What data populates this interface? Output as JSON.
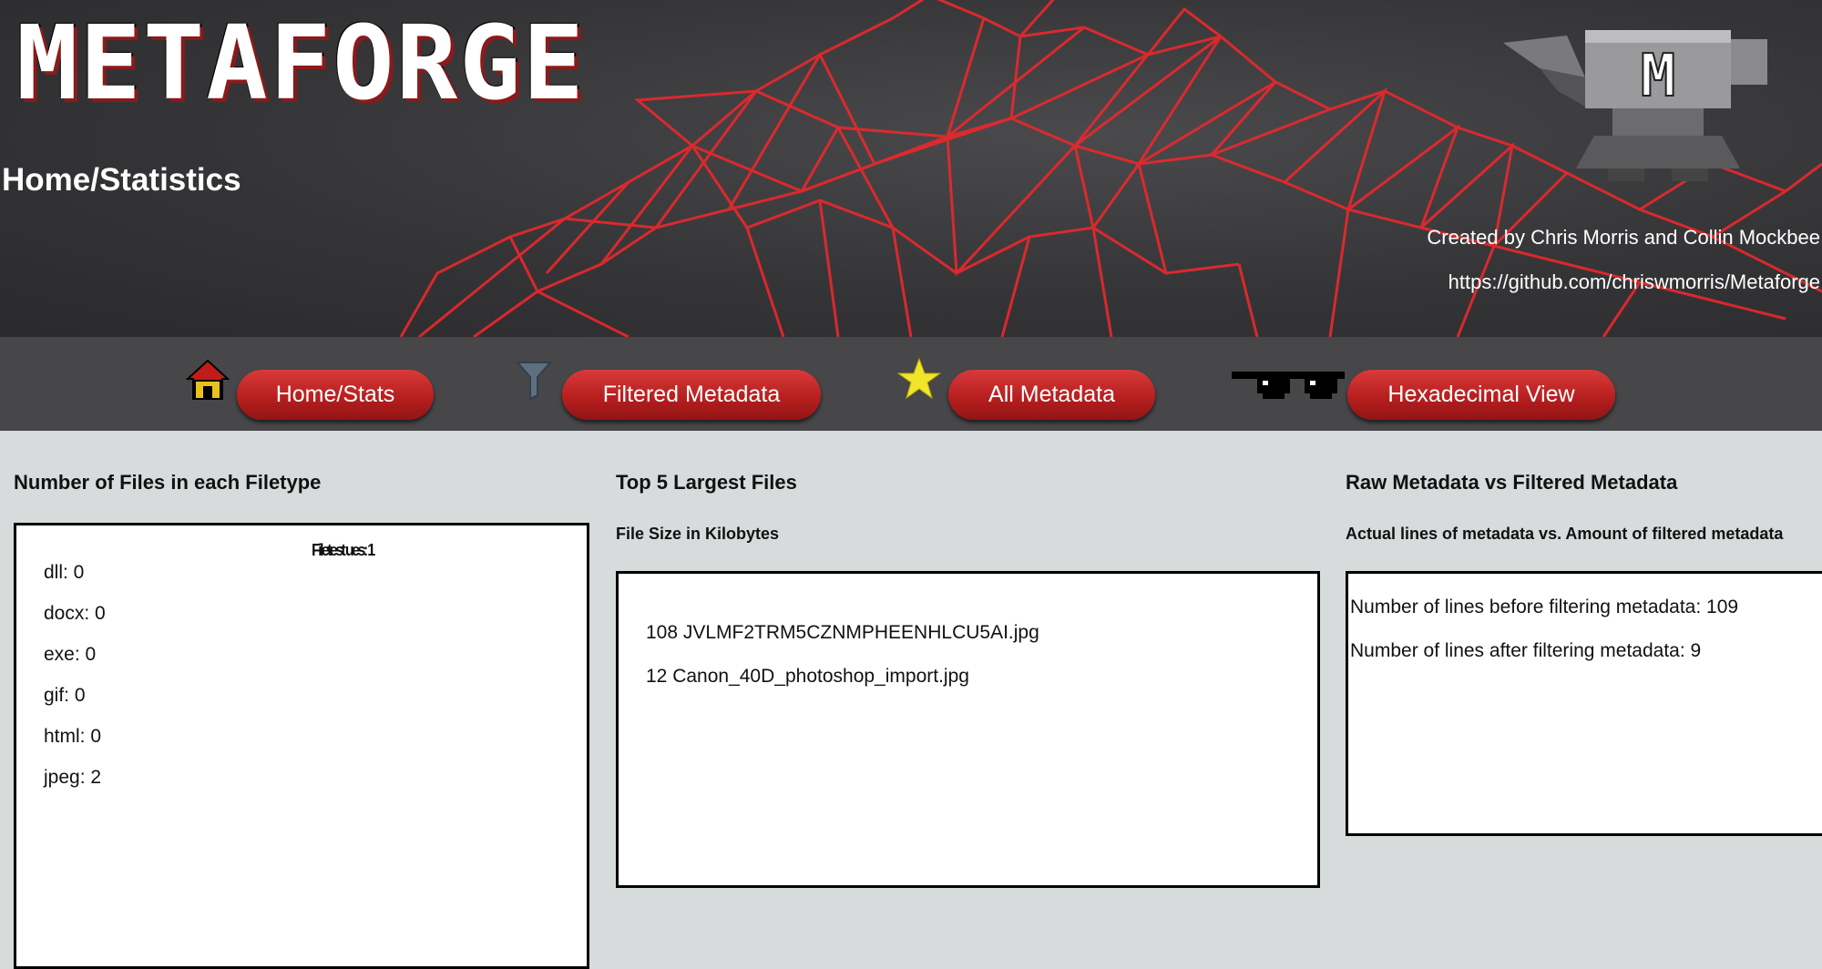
{
  "header": {
    "logo": "METAFORGE",
    "breadcrumb": "Home/Statistics",
    "credit_authors": "Created by Chris Morris and Collin Mockbee",
    "credit_url": "https://github.com/chriswmorris/Metaforge",
    "anvil_letter": "M"
  },
  "nav": {
    "home_label": "Home/Stats",
    "filtered_label": "Filtered Metadata",
    "all_label": "All Metadata",
    "hex_label": "Hexadecimal View"
  },
  "filetypes": {
    "title": "Number of Files in each Filetype",
    "garbled_text": "Filetest ues: 1",
    "items": [
      "dll: 0",
      "docx: 0",
      "exe: 0",
      "gif: 0",
      "html: 0",
      "jpeg: 2"
    ]
  },
  "largest": {
    "title": "Top 5 Largest Files",
    "subtitle": "File Size in Kilobytes",
    "items": [
      "108 JVLMF2TRM5CZNMPHEENHLCU5AI.jpg",
      "12 Canon_40D_photoshop_import.jpg"
    ]
  },
  "rawfiltered": {
    "title": "Raw Metadata vs Filtered Metadata",
    "subtitle": "Actual lines of metadata vs. Amount of filtered metadata",
    "before": "Number of lines before filtering metadata: 109",
    "after": "Number of lines after filtering metadata: 9"
  },
  "colors": {
    "accent_red": "#c62a2a",
    "mesh_red": "#e8282c",
    "content_bg": "#d8dbdc",
    "nav_bg": "#474749"
  }
}
